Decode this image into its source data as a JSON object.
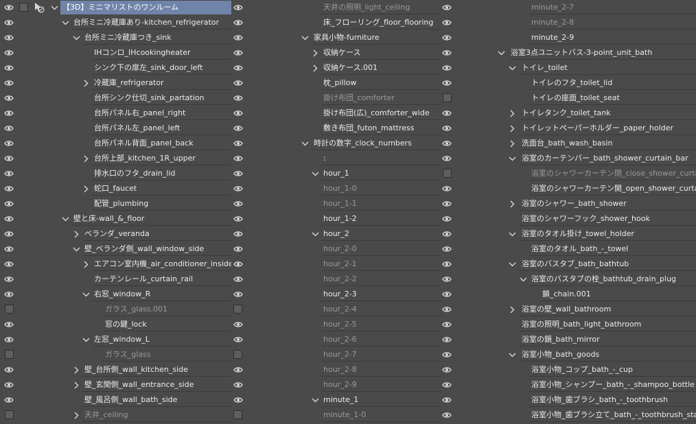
{
  "colors": {
    "panel_bg": "#4a4a4a",
    "row_line": "#3b3b3b",
    "selected_row": "#6f84a8",
    "dim_text": "#9a9a9a",
    "text": "#ececec"
  },
  "icons": {
    "visibility": "eye-icon",
    "expand": "chevron-right-icon",
    "collapse": "chevron-down-icon",
    "layer_tool": "layer-toggle-icon"
  },
  "layers": {
    "col1": [
      {
        "label": "【3D】ミニマリストのワンルーム",
        "chev": "down",
        "vis": "eye",
        "selected": true
      },
      {
        "label": "台所ミニ冷蔵庫あり-kitchen_refrigerator",
        "chev": "down",
        "vis": "eye"
      },
      {
        "label": "台所ミニ冷蔵庫つき_sink",
        "chev": "down",
        "vis": "eye"
      },
      {
        "label": "IHコンロ_IHcookingheater",
        "vis": "eye"
      },
      {
        "label": "シンク下の扉左_sink_door_left",
        "vis": "eye"
      },
      {
        "label": "冷蔵庫_refrigerator",
        "chev": "right",
        "vis": "eye"
      },
      {
        "label": "台所シンク仕切_sink_partation",
        "vis": "eye"
      },
      {
        "label": "台所パネル右_panel_right",
        "vis": "eye"
      },
      {
        "label": "台所パネル左_panel_left",
        "vis": "eye"
      },
      {
        "label": "台所パネル背面_panel_back",
        "vis": "eye"
      },
      {
        "label": "台所上部_kitchen_1R_upper",
        "chev": "right",
        "vis": "eye"
      },
      {
        "label": "排水口のフタ_drain_lid",
        "vis": "eye"
      },
      {
        "label": "蛇口_faucet",
        "chev": "right",
        "vis": "eye"
      },
      {
        "label": "配管_plumbing",
        "vis": "eye"
      },
      {
        "label": "壁と床-wall_&_floor",
        "chev": "down",
        "vis": "eye"
      },
      {
        "label": "ベランダ_veranda",
        "chev": "right",
        "vis": "eye"
      },
      {
        "label": "壁_ベランダ側_wall_window_side",
        "chev": "down",
        "vis": "eye"
      },
      {
        "label": "エアコン室内機_air_conditioner_inside",
        "chev": "right",
        "vis": "eye"
      },
      {
        "label": "カーテンレール_curtain_rail",
        "vis": "eye"
      },
      {
        "label": "右窓_window_R",
        "chev": "down",
        "vis": "eye"
      },
      {
        "label": "ガラス_glass.001",
        "vis": "box",
        "dim": true
      },
      {
        "label": "窓の鍵_lock",
        "vis": "eye"
      },
      {
        "label": "左窓_window_L",
        "chev": "down",
        "vis": "eye"
      },
      {
        "label": "ガラス_glass",
        "vis": "box",
        "dim": true
      },
      {
        "label": "壁_台所側_wall_kitchen_side",
        "chev": "right",
        "vis": "eye"
      },
      {
        "label": "壁_玄関側_wall_entrance_side",
        "chev": "right",
        "vis": "eye"
      },
      {
        "label": "壁_風呂側_wall_bath_side",
        "vis": "eye"
      },
      {
        "label": "天井_ceiling",
        "chev": "right",
        "vis": "box",
        "dim": true
      }
    ],
    "col2": [
      {
        "label": "天井の照明_light_ceiling",
        "vis": "eye",
        "dim": true
      },
      {
        "label": "床_フローリング_floor_flooring",
        "vis": "eye"
      },
      {
        "label": "家具小物-furniture",
        "chev": "down",
        "vis": "eye"
      },
      {
        "label": "収納ケース",
        "chev": "right",
        "vis": "eye"
      },
      {
        "label": "収納ケース.001",
        "chev": "right",
        "vis": "eye"
      },
      {
        "label": "枕_pillow",
        "vis": "eye"
      },
      {
        "label": "掛け布団_comforter",
        "vis": "box",
        "dim": true
      },
      {
        "label": "掛け布団(広)_comforter_wide",
        "vis": "eye"
      },
      {
        "label": "敷き布団_futon_mattress",
        "vis": "eye"
      },
      {
        "label": "時計の数字_clock_numbers",
        "chev": "down",
        "vis": "eye"
      },
      {
        "label": ":",
        "vis": "eye"
      },
      {
        "label": "hour_1",
        "chev": "down",
        "vis": "box"
      },
      {
        "label": "hour_1-0",
        "vis": "eye",
        "dim": true
      },
      {
        "label": "hour_1-1",
        "vis": "eye",
        "dim": true
      },
      {
        "label": "hour_1-2",
        "vis": "eye"
      },
      {
        "label": "hour_2",
        "chev": "down",
        "vis": "eye"
      },
      {
        "label": "hour_2-0",
        "vis": "eye",
        "dim": true
      },
      {
        "label": "hour_2-1",
        "vis": "eye",
        "dim": true
      },
      {
        "label": "hour_2-2",
        "vis": "eye",
        "dim": true
      },
      {
        "label": "hour_2-3",
        "vis": "eye"
      },
      {
        "label": "hour_2-4",
        "vis": "eye",
        "dim": true
      },
      {
        "label": "hour_2-5",
        "vis": "eye",
        "dim": true
      },
      {
        "label": "hour_2-6",
        "vis": "eye",
        "dim": true
      },
      {
        "label": "hour_2-7",
        "vis": "eye",
        "dim": true
      },
      {
        "label": "hour_2-8",
        "vis": "eye",
        "dim": true
      },
      {
        "label": "hour_2-9",
        "vis": "eye",
        "dim": true
      },
      {
        "label": "minute_1",
        "chev": "down",
        "vis": "eye"
      },
      {
        "label": "minute_1-0",
        "vis": "eye",
        "dim": true
      }
    ],
    "col3": [
      {
        "label": "minute_2-7",
        "dim": true
      },
      {
        "label": "minute_2-8",
        "dim": true
      },
      {
        "label": "minute_2-9"
      },
      {
        "label": "浴室3点ユニットバス-3-point_unit_bath",
        "chev": "down"
      },
      {
        "label": "トイレ_toilet",
        "chev": "down"
      },
      {
        "label": "トイレのフタ_toilet_lid"
      },
      {
        "label": "トイレの座面_toilet_seat"
      },
      {
        "label": "トイレタンク_toilet_tank",
        "chev": "right"
      },
      {
        "label": "トイレットペーパーホルダー_paper_holder",
        "chev": "right"
      },
      {
        "label": "洗面台_bath_wash_basin",
        "chev": "right"
      },
      {
        "label": "浴室のカーテンバー_bath_shower_curtain_bar",
        "chev": "down"
      },
      {
        "label": "浴室のシャワーカーテン閉_close_shower_curtain",
        "dim": true
      },
      {
        "label": "浴室のシャワーカーテン開_open_shower_curtain"
      },
      {
        "label": "浴室のシャワー_bath_shower",
        "chev": "right"
      },
      {
        "label": "浴室のシャワーフック_shower_hook"
      },
      {
        "label": "浴室のタオル掛け_towel_holder",
        "chev": "down"
      },
      {
        "label": "浴室のタオル_bath_-_towel"
      },
      {
        "label": "浴室のバスタブ_bath_bathtub",
        "chev": "down"
      },
      {
        "label": "浴室のバスタブの栓_bathtub_drain_plug",
        "chev": "down"
      },
      {
        "label": "鎖_chain.001"
      },
      {
        "label": "浴室の壁_wall_bathroom",
        "chev": "right"
      },
      {
        "label": "浴室の照明_bath_light_bathroom"
      },
      {
        "label": "浴室の鏡_bath_mirror"
      },
      {
        "label": "浴室小物_bath_goods",
        "chev": "down"
      },
      {
        "label": "浴室小物_コップ_bath_-_cup"
      },
      {
        "label": "浴室小物_シャンプー_bath_-_shampoo_bottle"
      },
      {
        "label": "浴室小物_歯ブラシ_bath_-_toothbrush"
      },
      {
        "label": "浴室小物_歯ブラシ立て_bath_-_toothbrush_stan"
      }
    ]
  }
}
